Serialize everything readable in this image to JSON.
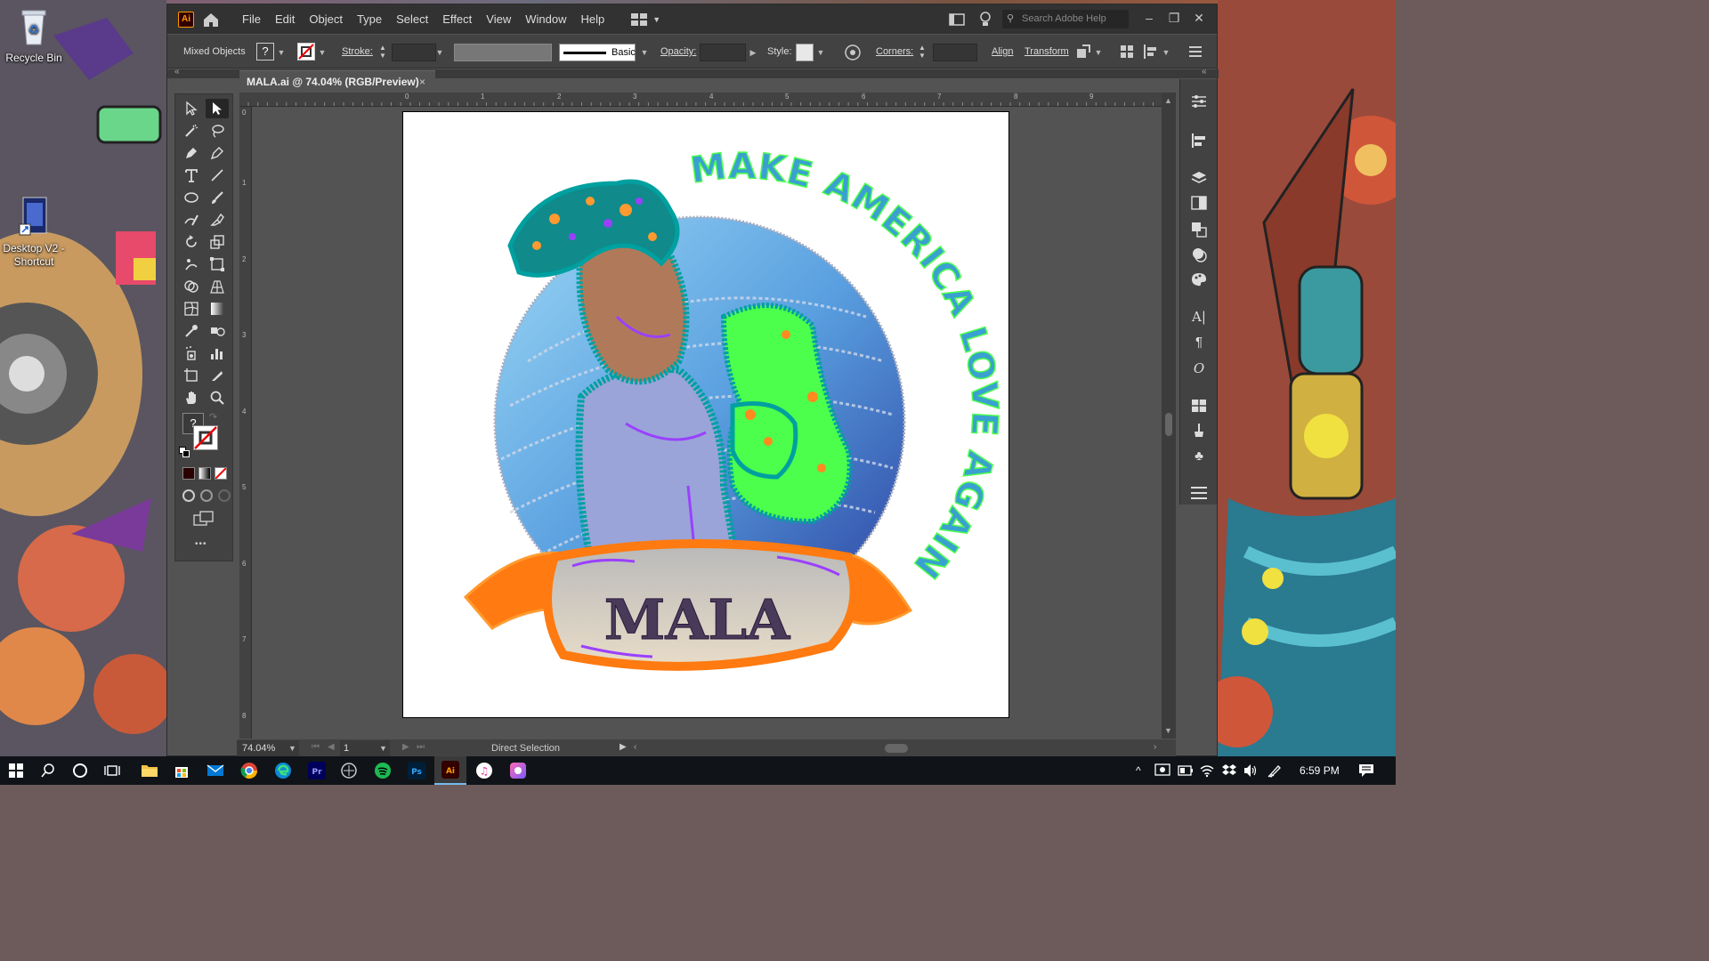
{
  "desktop": {
    "icons": [
      {
        "label": "Recycle Bin"
      },
      {
        "label": "Desktop V2 - Shortcut"
      }
    ]
  },
  "app": {
    "logo": "Ai",
    "menu": [
      "File",
      "Edit",
      "Object",
      "Type",
      "Select",
      "Effect",
      "View",
      "Window",
      "Help"
    ],
    "search_placeholder": "Search Adobe Help"
  },
  "control_bar": {
    "selection": "Mixed Objects",
    "fill_unknown": "?",
    "stroke_label": "Stroke:",
    "brush_label": "Basic",
    "opacity_label": "Opacity:",
    "style_label": "Style:",
    "corners_label": "Corners:",
    "align_label": "Align",
    "transform_label": "Transform"
  },
  "document": {
    "tab_title": "MALA.ai @ 74.04% (RGB/Preview)",
    "close": "×",
    "ruler_top": [
      "0",
      "1",
      "2",
      "3",
      "4",
      "5",
      "6",
      "7",
      "8",
      "9"
    ],
    "ruler_left": [
      "0",
      "1",
      "2",
      "3",
      "4",
      "5",
      "6",
      "7",
      "8"
    ]
  },
  "artwork": {
    "headline": "MAKE AMERICA LOVE AGAIN",
    "banner_text": "MALA"
  },
  "status": {
    "zoom": "74.04%",
    "artboard_number": "1",
    "tool_name": "Direct Selection"
  },
  "toolbar": {
    "fill_unknown": "?",
    "more": "•••"
  },
  "taskbar": {
    "time": "6:59 PM"
  },
  "colors": {
    "ai_orange": "#ff9a00",
    "ai_bg": "#330000",
    "teal": "#00a0a0",
    "green": "#4cff4c",
    "purple": "#9a40ff",
    "orange": "#ff7a10",
    "blue": "#3a6ed0"
  }
}
